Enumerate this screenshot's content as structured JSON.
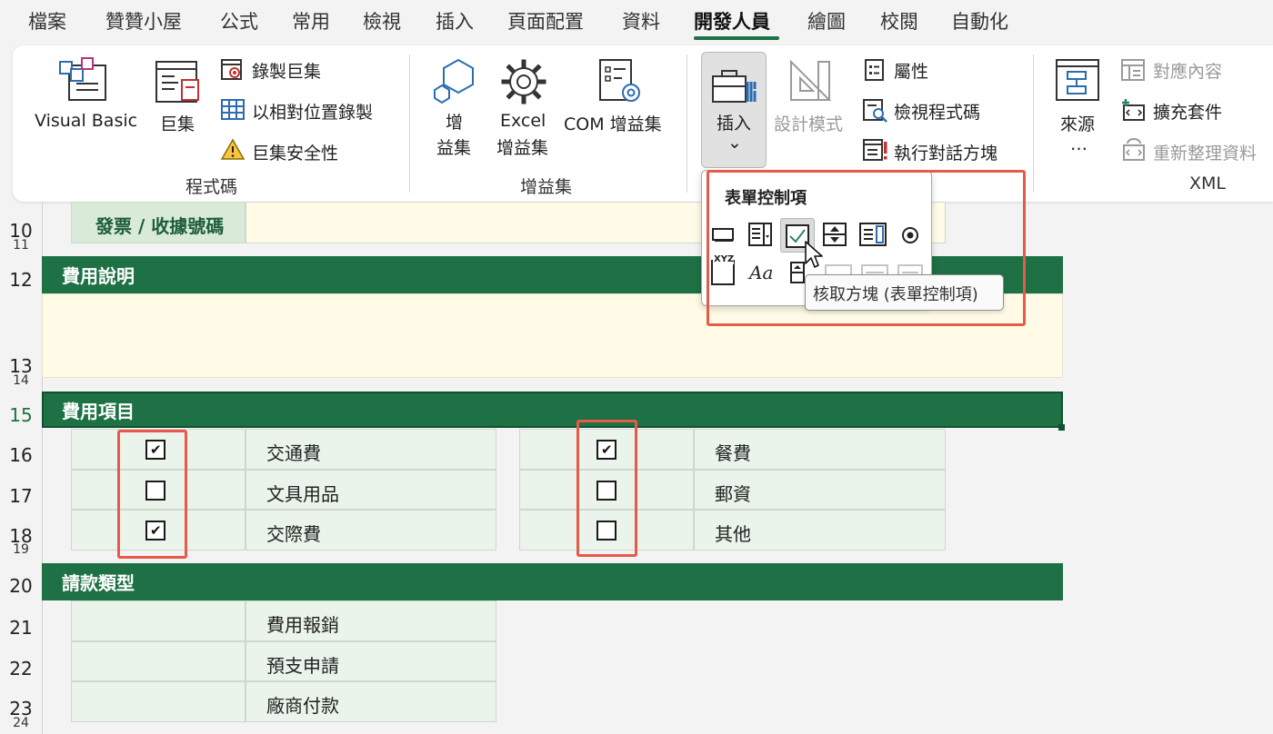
{
  "menu": {
    "tabs": [
      "檔案",
      "贊贊小屋",
      "公式",
      "常用",
      "檢視",
      "插入",
      "頁面配置",
      "資料",
      "開發人員",
      "繪圖",
      "校閱",
      "自動化"
    ],
    "active_tab": "開發人員"
  },
  "ribbon": {
    "code_group": {
      "visual_basic": "Visual Basic",
      "macros": "巨集",
      "record_macro": "錄製巨集",
      "relative_ref": "以相對位置錄製",
      "macro_security": "巨集安全性",
      "label": "程式碼"
    },
    "addins_group": {
      "addins_line1": "增",
      "addins_line2": "益集",
      "excel_addins_line1": "Excel",
      "excel_addins_line2": "增益集",
      "com_addins": "COM 增益集",
      "label": "增益集"
    },
    "controls_group": {
      "insert": "插入",
      "insert_arrow": "⌄",
      "design_mode": "設計模式",
      "properties": "屬性",
      "view_code": "檢視程式碼",
      "run_dialog": "執行對話方塊"
    },
    "xml_group": {
      "source_line1": "來源",
      "source_line2": "…",
      "map_properties": "對應內容",
      "expansion_packs": "擴充套件",
      "refresh_data": "重新整理資料",
      "label": "XML"
    }
  },
  "dropdown": {
    "title": "表單控制項",
    "tooltip": "核取方塊 (表單控制項)",
    "label_text": "Aa",
    "xyz": "XYZ"
  },
  "sheet": {
    "row_numbers": {
      "r10": "10",
      "r11": "11",
      "r12": "12",
      "r13": "13",
      "r14": "14",
      "r15": "15",
      "r16": "16",
      "r17": "17",
      "r18": "18",
      "r19": "19",
      "r20": "20",
      "r21": "21",
      "r22": "22",
      "r23": "23",
      "r24": "24"
    },
    "invoice_label": "發票 / 收據號碼",
    "section_description": "費用說明",
    "section_items": "費用項目",
    "section_type": "請款類型",
    "left_items": [
      {
        "label": "交通費",
        "checked": true
      },
      {
        "label": "文具用品",
        "checked": false
      },
      {
        "label": "交際費",
        "checked": true
      }
    ],
    "right_items": [
      {
        "label": "餐費",
        "checked": true
      },
      {
        "label": "郵資",
        "checked": false
      },
      {
        "label": "其他",
        "checked": false
      }
    ],
    "claim_types": [
      "費用報銷",
      "預支申請",
      "廠商付款"
    ],
    "check_glyph": "✔"
  },
  "colors": {
    "accent": "#1e7145",
    "highlight": "#e8594a",
    "cell_bg": "#eaf4ea",
    "note_bg": "#fffbe6"
  }
}
